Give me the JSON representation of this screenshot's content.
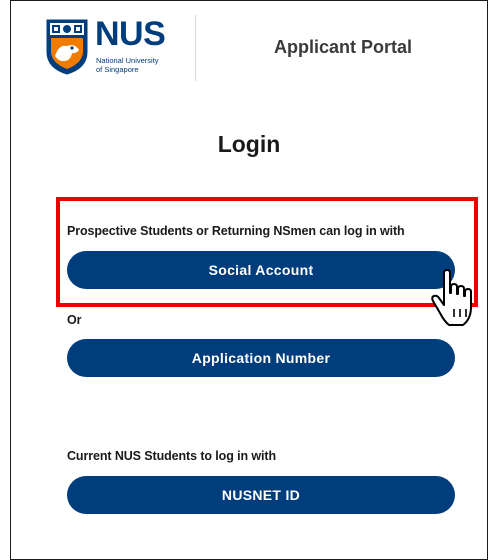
{
  "header": {
    "logo": {
      "wordmark": "NUS",
      "subtitle_line1": "National University",
      "subtitle_line2": "of Singapore"
    },
    "portal_title": "Applicant Portal"
  },
  "main": {
    "title": "Login",
    "prospective_label": "Prospective Students or Returning NSmen can log in with",
    "social_button": "Social Account",
    "or_label": "Or",
    "application_button": "Application Number",
    "current_label": "Current NUS Students to log in with",
    "nusnet_button": "NUSNET ID"
  },
  "colors": {
    "brand_blue": "#003d7c",
    "brand_orange": "#ef7c00",
    "highlight_red": "#ee0000"
  },
  "icons": [
    "nus-crest-icon",
    "hand-pointer-cursor-icon"
  ]
}
